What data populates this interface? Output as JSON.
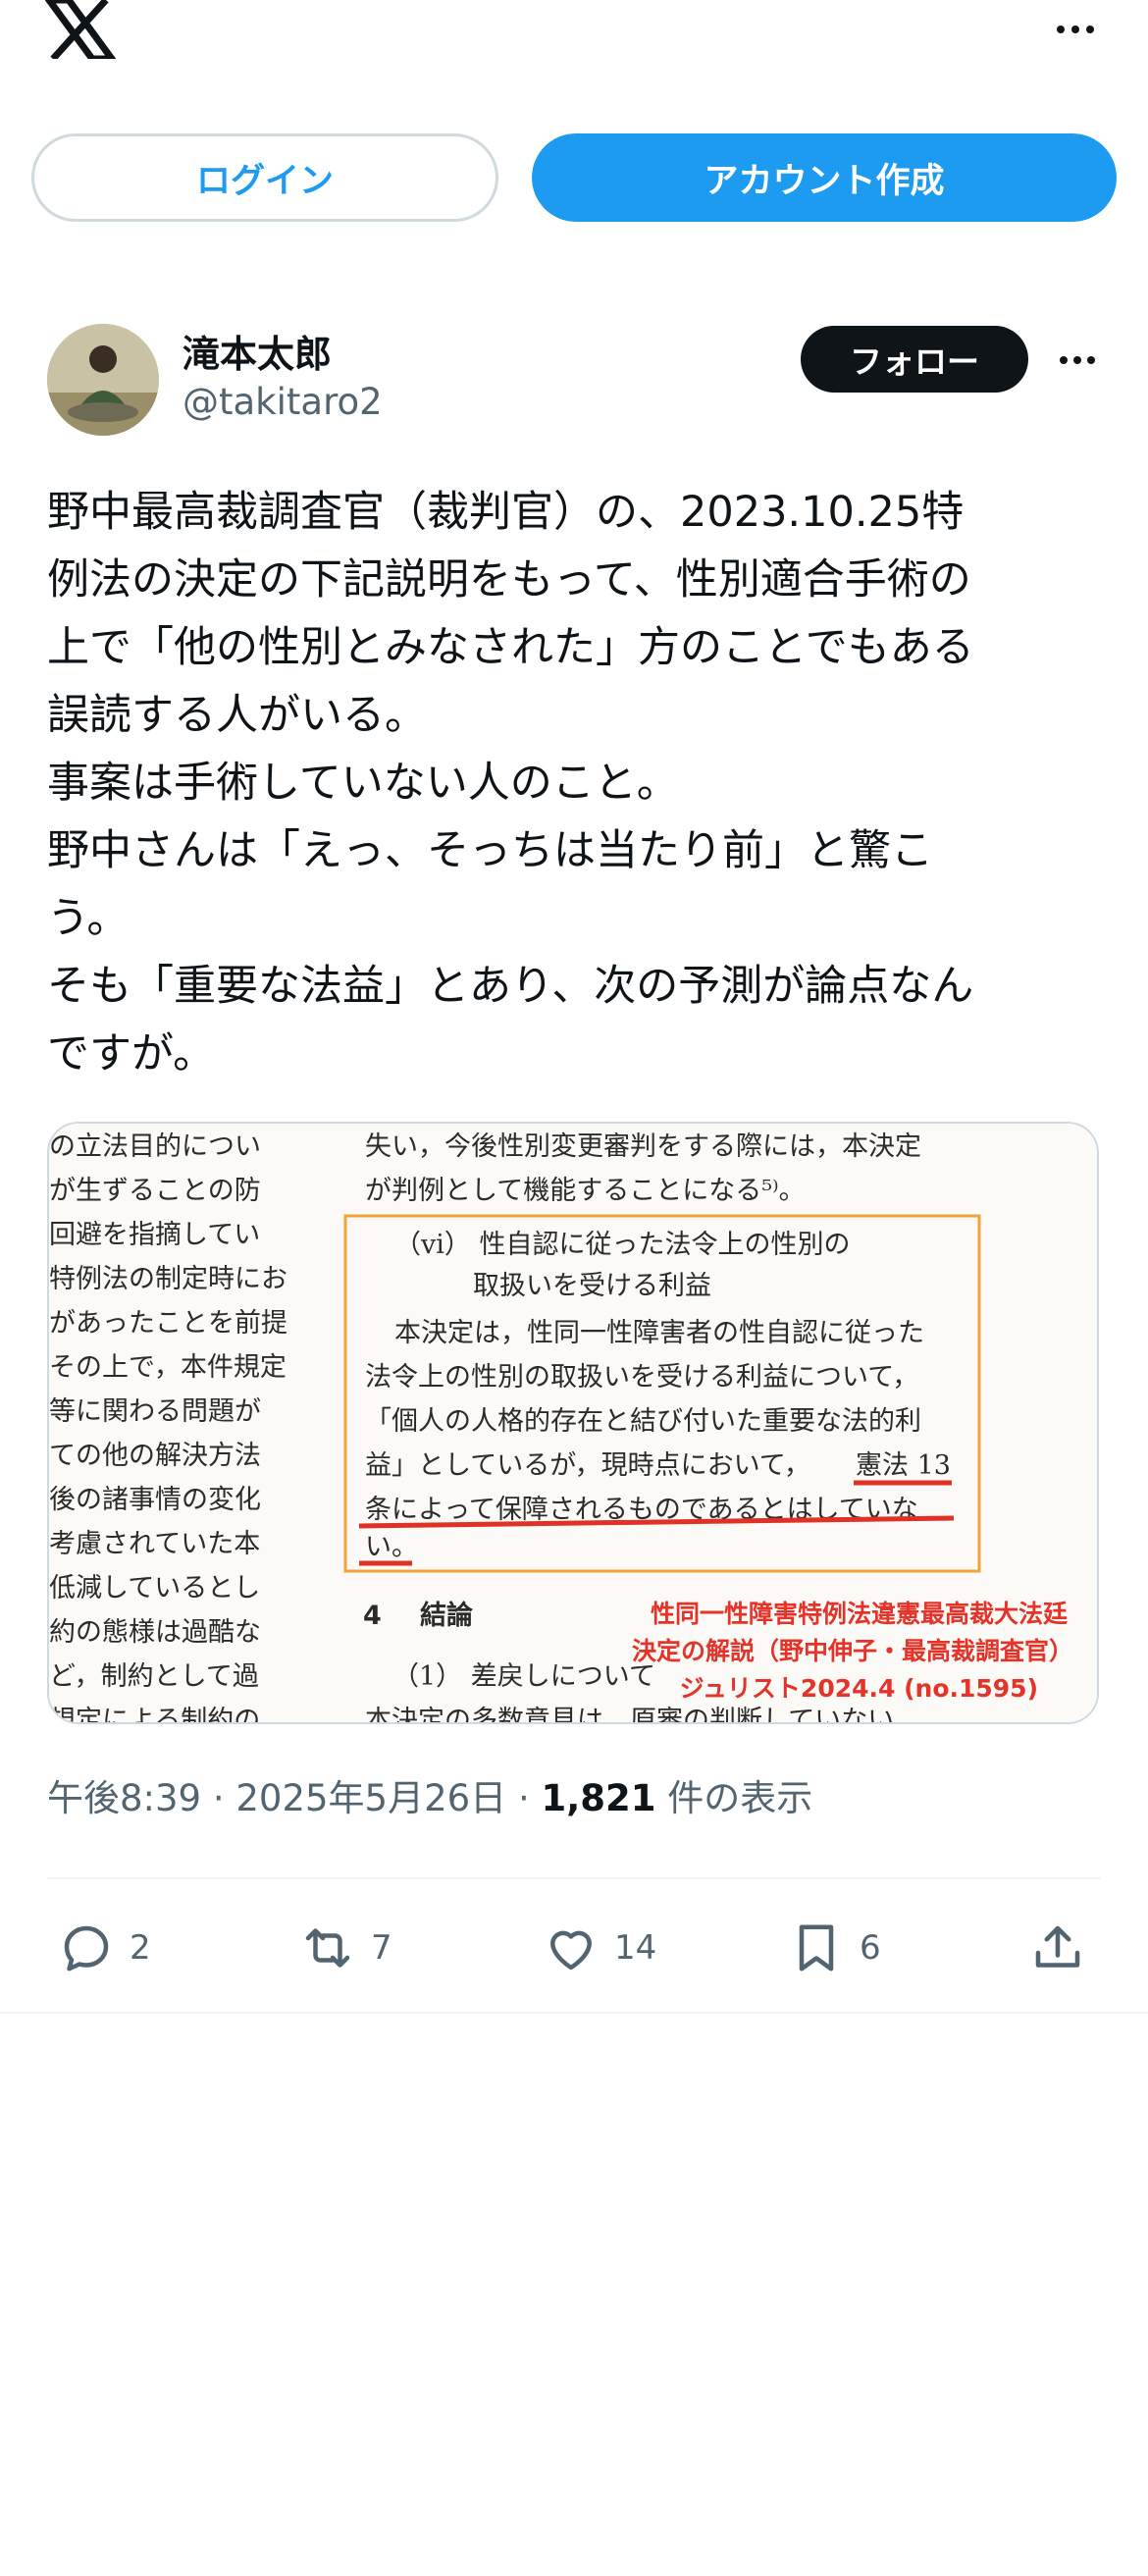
{
  "top_bar": {
    "logo": "x-logo",
    "more": "more-icon"
  },
  "auth": {
    "login_label": "ログイン",
    "signup_label": "アカウント作成"
  },
  "author": {
    "display_name": "滝本太郎",
    "handle": "@takitaro2",
    "follow_label": "フォロー"
  },
  "tweet": {
    "text": "野中最高裁調査官（裁判官）の、2023.10.25特\n例法の決定の下記説明をもって、性別適合手術の\n上で「他の性別とみなされた」方のことでもある\n誤読する人がいる。\n事案は手術していない人のこと。\n野中さんは「えっ、そっちは当たり前」と驚こ\nう。\nそも「重要な法益」とあり、次の予測が論点なん\nですが。"
  },
  "media": {
    "left_column": [
      "の立法目的につい",
      "が生ずることの防",
      "回避を指摘してい",
      "特例法の制定時にお",
      "があったことを前提",
      "その上で，本件規定",
      "等に関わる問題が",
      "ての他の解決方法",
      "後の諸事情の変化",
      "考慮されていた本",
      "低減しているとし",
      "約の態様は過酷な",
      "ど，制約として過",
      "規定による制約の"
    ],
    "right_top": [
      "失い，今後性別変更審判をする際には，本決定",
      "が判例として機能することになる⁵⁾。"
    ],
    "box_heading": [
      "（vi） 性自認に従った法令上の性別の",
      "取扱いを受ける利益"
    ],
    "box_body": [
      "本決定は，性同一性障害者の性自認に従った",
      "法令上の性別の取扱いを受ける利益について，",
      "「個人の人格的存在と結び付いた重要な法的利",
      "益」としているが，現時点において，",
      "憲法 13",
      "条によって保障されるものであるとはしていな",
      "い。"
    ],
    "section_num": "4",
    "section_title": "結論",
    "sub_item": "（1） 差戻しについて",
    "cut_line": "本決定の多数意見は，原審の判断していない",
    "caption": [
      "性同一性障害特例法違憲最高裁大法廷",
      "決定の解説（野中伸子・最高裁調査官）",
      "ジュリスト2024.4 (no.1595)"
    ],
    "colors": {
      "box": "#f0a33a",
      "underline": "#e03127",
      "caption": "#e5332a"
    }
  },
  "meta": {
    "time": "午後8:39",
    "sep": "·",
    "date": "2025年5月26日",
    "views_count": "1,821",
    "views_label": "件の表示"
  },
  "actions": {
    "reply_count": "2",
    "retweet_count": "7",
    "like_count": "14",
    "bookmark_count": "6"
  },
  "colors": {
    "accent": "#1d9bf0",
    "text": "#0f1419",
    "muted": "#536471"
  }
}
